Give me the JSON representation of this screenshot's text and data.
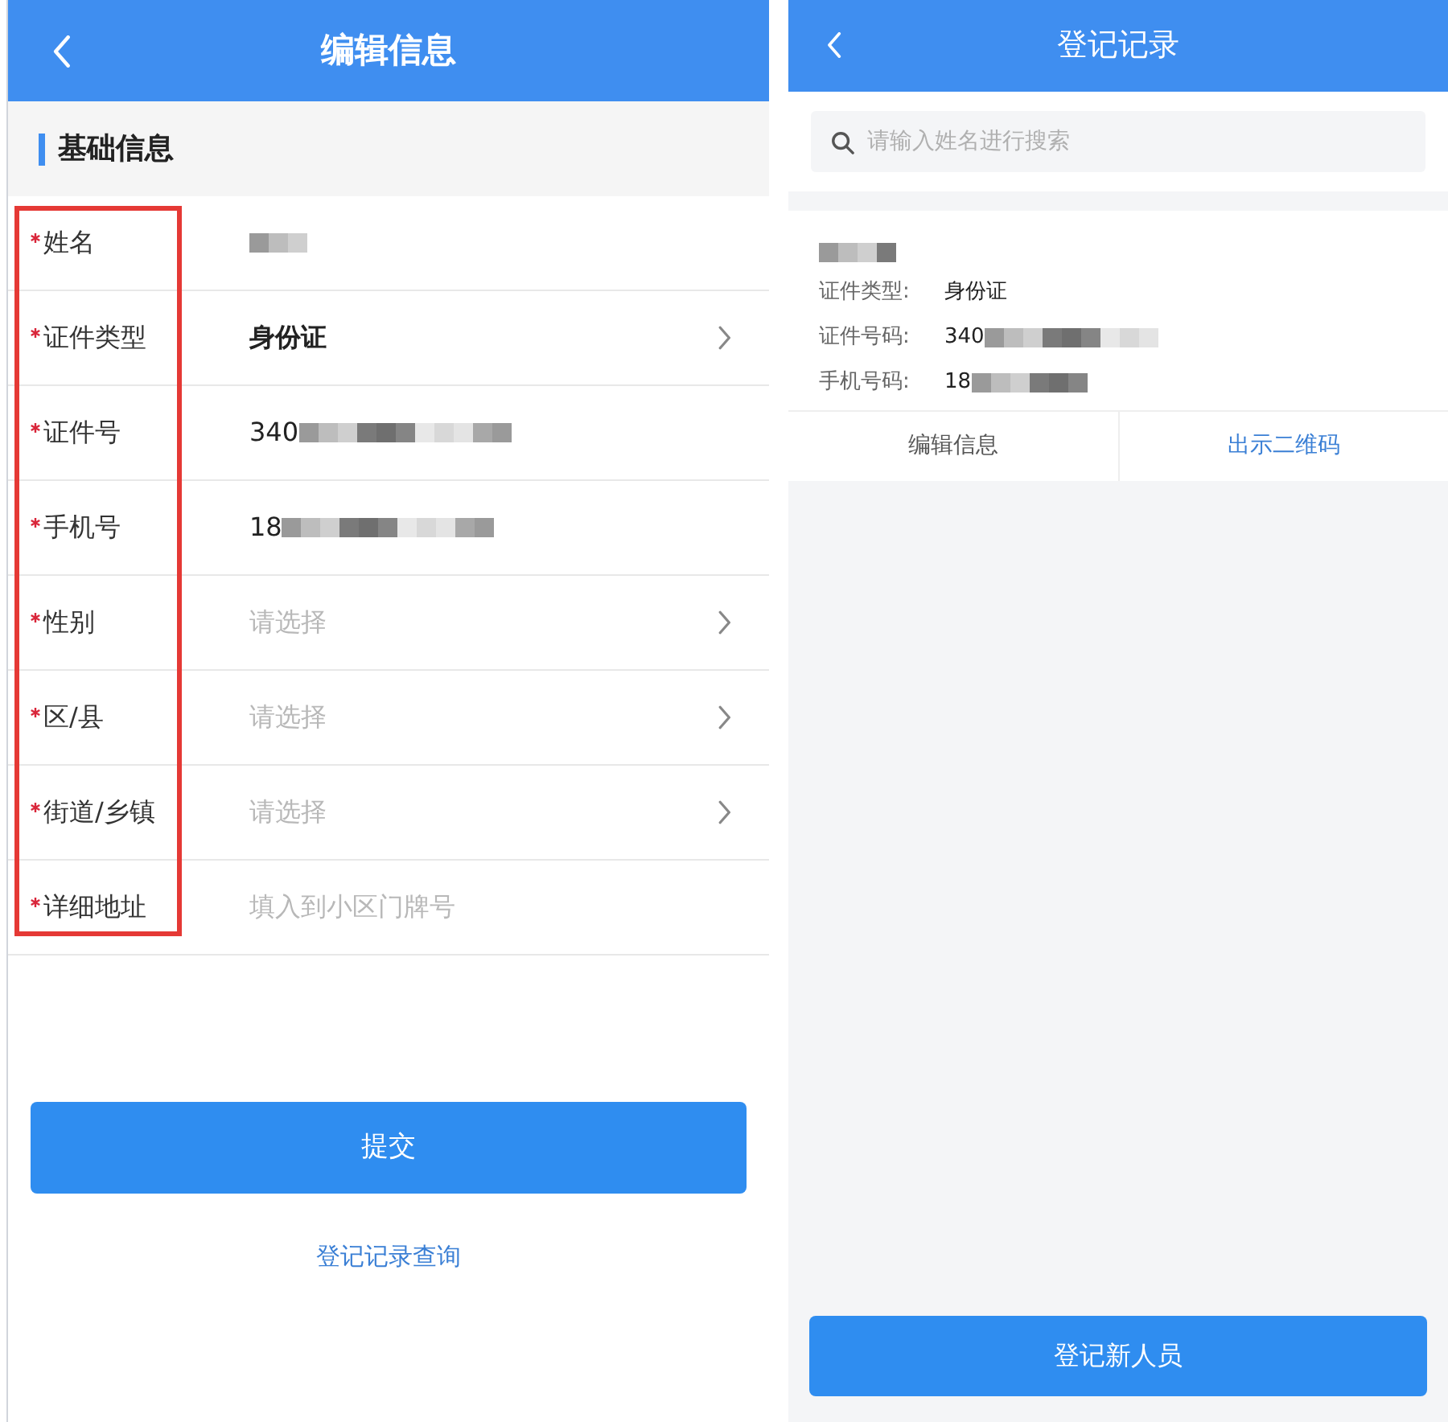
{
  "edit_page": {
    "title": "编辑信息",
    "section": "基础信息",
    "labels_outlined": true,
    "fields": [
      {
        "label": "姓名",
        "required": true,
        "kind": "text",
        "masked": true
      },
      {
        "label": "证件类型",
        "required": true,
        "kind": "select",
        "value": "身份证",
        "masked": false
      },
      {
        "label": "证件号",
        "required": true,
        "kind": "text",
        "value": "340",
        "masked": true
      },
      {
        "label": "手机号",
        "required": true,
        "kind": "text",
        "value": "18",
        "masked": true
      },
      {
        "label": "性别",
        "required": true,
        "kind": "select",
        "placeholder": "请选择",
        "masked": false
      },
      {
        "label": "区/县",
        "required": true,
        "kind": "select",
        "placeholder": "请选择",
        "masked": false
      },
      {
        "label": "街道/乡镇",
        "required": true,
        "kind": "select",
        "placeholder": "请选择",
        "masked": false
      },
      {
        "label": "详细地址",
        "required": true,
        "kind": "text",
        "placeholder": "填入到小区门牌号",
        "masked": false
      }
    ],
    "submit": "提交",
    "link": "登记记录查询"
  },
  "records_page": {
    "title": "登记记录",
    "search": {
      "placeholder": "请输入姓名进行搜索"
    },
    "record": {
      "name_masked": true,
      "details": [
        {
          "label": "证件类型:",
          "value": "身份证",
          "masked": false
        },
        {
          "label": "证件号码:",
          "value": "340",
          "masked": true
        },
        {
          "label": "手机号码:",
          "value": "18",
          "masked": true
        }
      ],
      "actions": [
        {
          "label": "编辑信息",
          "kind": "plain"
        },
        {
          "label": "出示二维码",
          "kind": "link"
        }
      ]
    },
    "add_button": "登记新人员"
  }
}
